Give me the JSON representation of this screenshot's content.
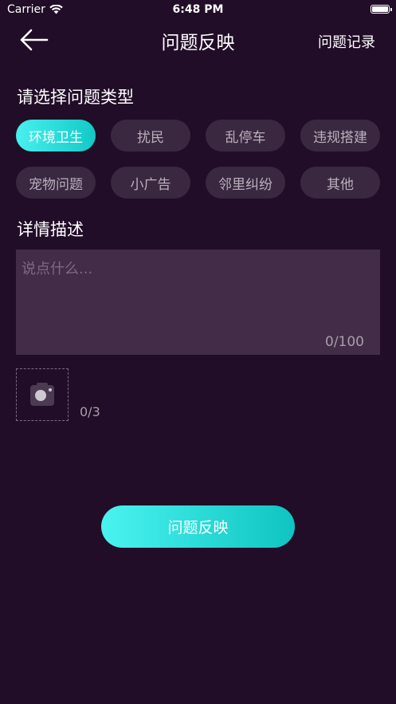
{
  "status_bar": {
    "carrier": "Carrier",
    "time": "6:48 PM"
  },
  "nav": {
    "title": "问题反映",
    "right_link": "问题记录"
  },
  "category": {
    "label": "请选择问题类型",
    "options": [
      "环境卫生",
      "扰民",
      "乱停车",
      "违规搭建",
      "宠物问题",
      "小广告",
      "邻里纠纷",
      "其他"
    ],
    "selected": "环境卫生"
  },
  "detail": {
    "label": "详情描述",
    "placeholder": "说点什么...",
    "value": "",
    "char_count": "0/100"
  },
  "photos": {
    "count": "0/3"
  },
  "submit": {
    "label": "问题反映"
  },
  "colors": {
    "background": "#220d28",
    "chip_bg": "#3a2740",
    "input_bg": "#432c48",
    "accent_start": "#48f0ee",
    "accent_end": "#12c9c6"
  }
}
